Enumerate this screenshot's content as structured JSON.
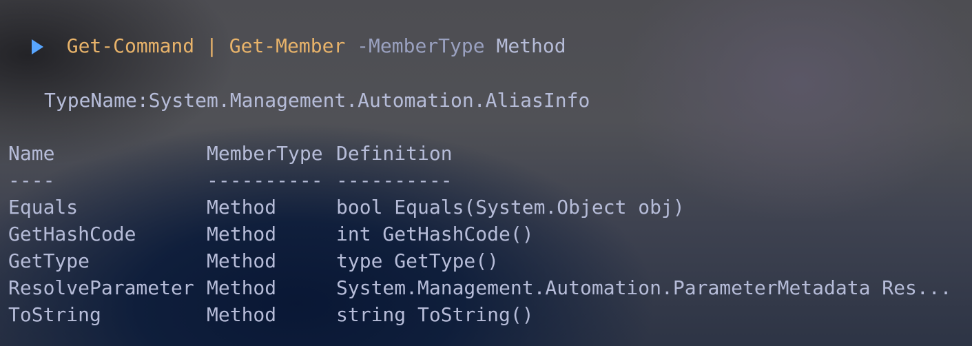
{
  "prompt": {
    "command1": "Get-Command",
    "pipe": "|",
    "command2": "Get-Member",
    "parameter": "-MemberType",
    "argument": "Method"
  },
  "output": {
    "typename": "TypeName:System.Management.Automation.AliasInfo",
    "headers": {
      "name": "Name",
      "member_type": "MemberType",
      "definition": "Definition"
    },
    "underlines": {
      "name": "----",
      "member_type": "----------",
      "definition": "----------"
    },
    "rows": [
      {
        "name": "Equals",
        "member_type": "Method",
        "definition": "bool Equals(System.Object obj)"
      },
      {
        "name": "GetHashCode",
        "member_type": "Method",
        "definition": "int GetHashCode()"
      },
      {
        "name": "GetType",
        "member_type": "Method",
        "definition": "type GetType()"
      },
      {
        "name": "ResolveParameter",
        "member_type": "Method",
        "definition": "System.Management.Automation.ParameterMetadata Res..."
      },
      {
        "name": "ToString",
        "member_type": "Method",
        "definition": "string ToString()"
      }
    ]
  },
  "colors": {
    "prompt_arrow": "#58a6ff",
    "command": "#e8b36a",
    "text": "#b6bcd8"
  }
}
